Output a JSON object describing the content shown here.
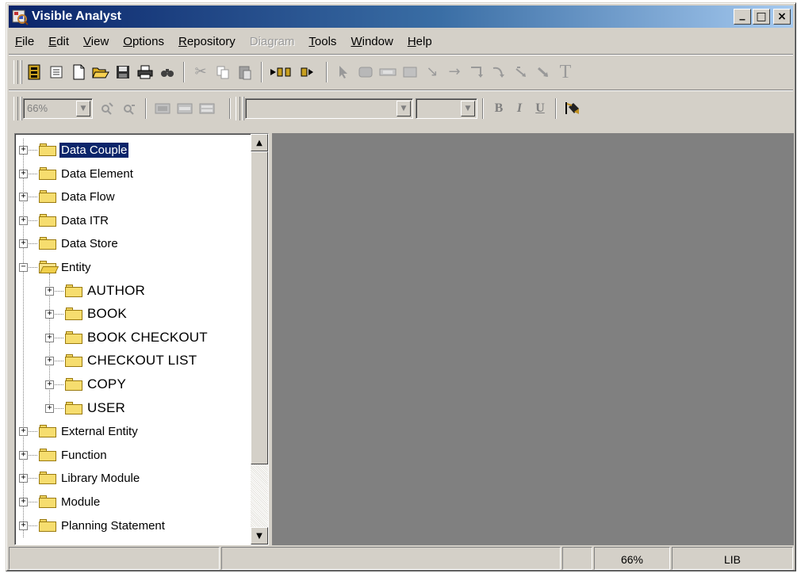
{
  "window": {
    "title": "Visible Analyst",
    "minimize": "_",
    "maximize": "□",
    "close": "×"
  },
  "menu": [
    {
      "label": "File",
      "disabled": false
    },
    {
      "label": "Edit",
      "disabled": false
    },
    {
      "label": "View",
      "disabled": false
    },
    {
      "label": "Options",
      "disabled": false
    },
    {
      "label": "Repository",
      "disabled": false
    },
    {
      "label": "Diagram",
      "disabled": true
    },
    {
      "label": "Tools",
      "disabled": false
    },
    {
      "label": "Window",
      "disabled": false
    },
    {
      "label": "Help",
      "disabled": false
    }
  ],
  "toolbar": {
    "zoom_value": "66%",
    "font_value": "",
    "size_value": "",
    "bold": "B",
    "italic": "I",
    "underline": "U"
  },
  "tree": {
    "items": [
      {
        "label": "Data Couple",
        "level": 0,
        "selected": true,
        "open": false
      },
      {
        "label": "Data Element",
        "level": 0,
        "selected": false,
        "open": false
      },
      {
        "label": "Data Flow",
        "level": 0,
        "selected": false,
        "open": false
      },
      {
        "label": "Data ITR",
        "level": 0,
        "selected": false,
        "open": false
      },
      {
        "label": "Data Store",
        "level": 0,
        "selected": false,
        "open": false
      },
      {
        "label": "Entity",
        "level": 0,
        "selected": false,
        "open": true
      },
      {
        "label": "AUTHOR",
        "level": 1,
        "selected": false,
        "open": false
      },
      {
        "label": "BOOK",
        "level": 1,
        "selected": false,
        "open": false
      },
      {
        "label": "BOOK CHECKOUT",
        "level": 1,
        "selected": false,
        "open": false
      },
      {
        "label": "CHECKOUT LIST",
        "level": 1,
        "selected": false,
        "open": false
      },
      {
        "label": "COPY",
        "level": 1,
        "selected": false,
        "open": false
      },
      {
        "label": "USER",
        "level": 1,
        "selected": false,
        "open": false
      },
      {
        "label": "External Entity",
        "level": 0,
        "selected": false,
        "open": false
      },
      {
        "label": "Function",
        "level": 0,
        "selected": false,
        "open": false
      },
      {
        "label": "Library Module",
        "level": 0,
        "selected": false,
        "open": false
      },
      {
        "label": "Module",
        "level": 0,
        "selected": false,
        "open": false
      },
      {
        "label": "Planning Statement",
        "level": 0,
        "selected": false,
        "open": false
      }
    ]
  },
  "statusbar": {
    "pane1": "",
    "pane2": "",
    "pane3": "",
    "zoom": "66%",
    "mode": "LIB"
  }
}
